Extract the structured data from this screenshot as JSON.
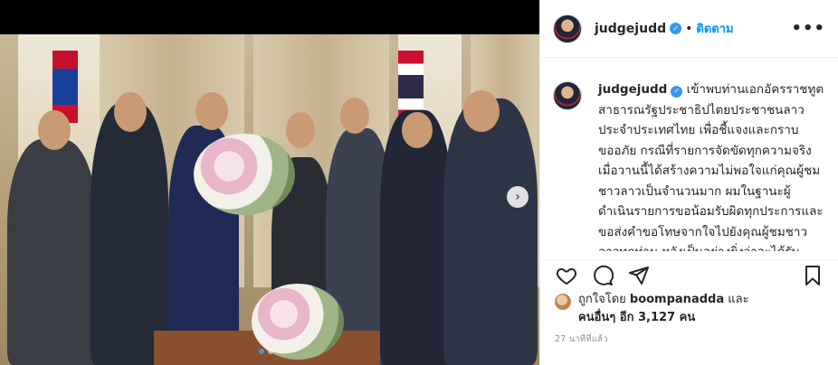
{
  "post": {
    "username": "judgejudd",
    "verified_icon": "verified-badge-icon",
    "separator": "•",
    "follow_label": "ติดตาม",
    "more_label": "•••"
  },
  "caption": {
    "username": "judgejudd",
    "text": "เข้าพบท่านเอกอัครราชทูตสาธารณรัฐประชาธิปไตยประชาชนลาวประจำประเทศไทย เพื่อชี้แจงและกราบขออภัย กรณีที่รายการจัดขัดทุกความจริงเมื่อวานนี้ได้สร้างความไม่พอใจแก่คุณผู้ชมชาวลาวเป็นจำนวนมาก ผมในฐานะผู้ดำเนินรายการขอน้อมรับผิดทุกประการและขอส่งคำขอโทษจากใจไปยังคุณผู้ชมชาวลาวทุกท่าน หวังเป็นอย่างยิ่งว่าจะได้รับความกรุณา มอบโอกาสให้ได้ปรับปรุง"
  },
  "likes": {
    "prefix": "ถูกใจโดย ",
    "liker": "boompanadda",
    "middle": " และ",
    "others": "คนอื่นๆ อีก 3,127 คน"
  },
  "timestamp": "27 นาทีที่แล้ว",
  "media": {
    "carousel_next": "›",
    "carousel_index": 1,
    "carousel_count": 2
  },
  "colors": {
    "accent": "#0095f6",
    "verified": "#3897f0",
    "text": "#262626",
    "muted": "#8e8e8e"
  }
}
